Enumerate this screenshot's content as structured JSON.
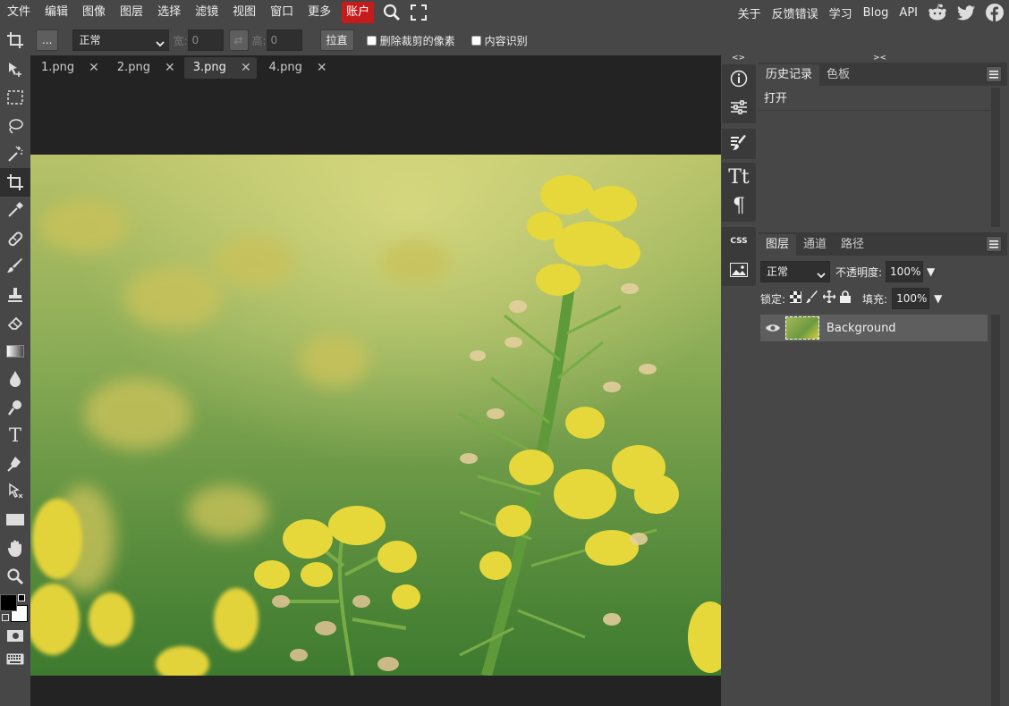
{
  "menubar": {
    "items": [
      "文件",
      "编辑",
      "图像",
      "图层",
      "选择",
      "滤镜",
      "视图",
      "窗口",
      "更多"
    ],
    "account": "账户",
    "right_links": [
      "关于",
      "反馈错误",
      "学习",
      "Blog",
      "API"
    ]
  },
  "options": {
    "more_label": "...",
    "mode_value": "正常",
    "width_label": "宽:",
    "width_value": "0",
    "height_label": "高:",
    "height_value": "0",
    "straighten_label": "拉直",
    "delete_cropped_label": "删除裁剪的像素",
    "content_aware_label": "内容识别"
  },
  "tabs": [
    {
      "label": "1.png",
      "active": false
    },
    {
      "label": "2.png",
      "active": false
    },
    {
      "label": "3.png",
      "active": true
    },
    {
      "label": "4.png",
      "active": false
    }
  ],
  "history_panel": {
    "tabs": [
      "历史记录",
      "色板"
    ],
    "items": [
      "打开"
    ]
  },
  "layers_panel": {
    "tabs": [
      "图层",
      "通道",
      "路径"
    ],
    "blend_mode": "正常",
    "opacity_label": "不透明度:",
    "opacity_value": "100%",
    "lock_label": "锁定:",
    "fill_label": "填充:",
    "fill_value": "100%",
    "layers": [
      {
        "name": "Background",
        "visible": true
      }
    ]
  },
  "strip": {
    "css_label": "CSS",
    "collapse_left": "<>",
    "collapse_right": "><"
  },
  "colors": {
    "accent_red": "#c41c1c",
    "foreground": "#000000",
    "background": "#ffffff"
  }
}
